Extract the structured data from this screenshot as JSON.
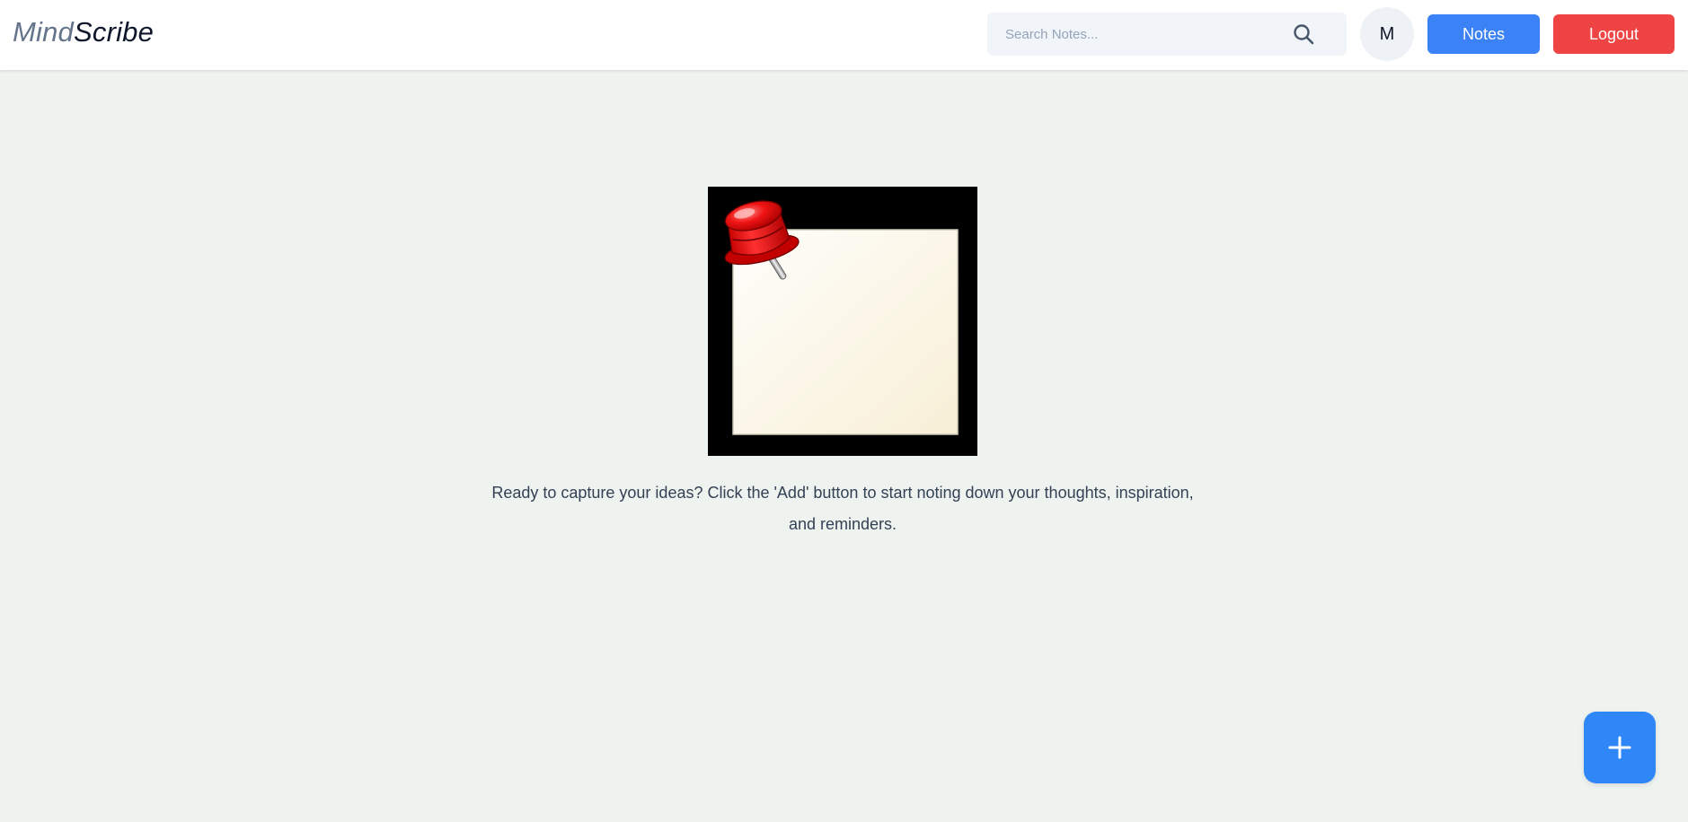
{
  "app": {
    "logo_part1": "Mind",
    "logo_part2": "Scribe"
  },
  "header": {
    "search": {
      "placeholder": "Search Notes...",
      "value": "",
      "icon": "search-icon"
    },
    "avatar_initial": "M",
    "notes_label": "Notes",
    "logout_label": "Logout"
  },
  "main": {
    "illustration": "pinned-note-icon",
    "empty_message": "Ready to capture your ideas? Click the 'Add' button to start noting down your thoughts, inspiration, and reminders."
  },
  "fab": {
    "icon": "plus-icon"
  },
  "colors": {
    "background": "#eff3f0",
    "primary": "#3b82f6",
    "danger": "#ef4444",
    "fab": "#2f86f6"
  }
}
